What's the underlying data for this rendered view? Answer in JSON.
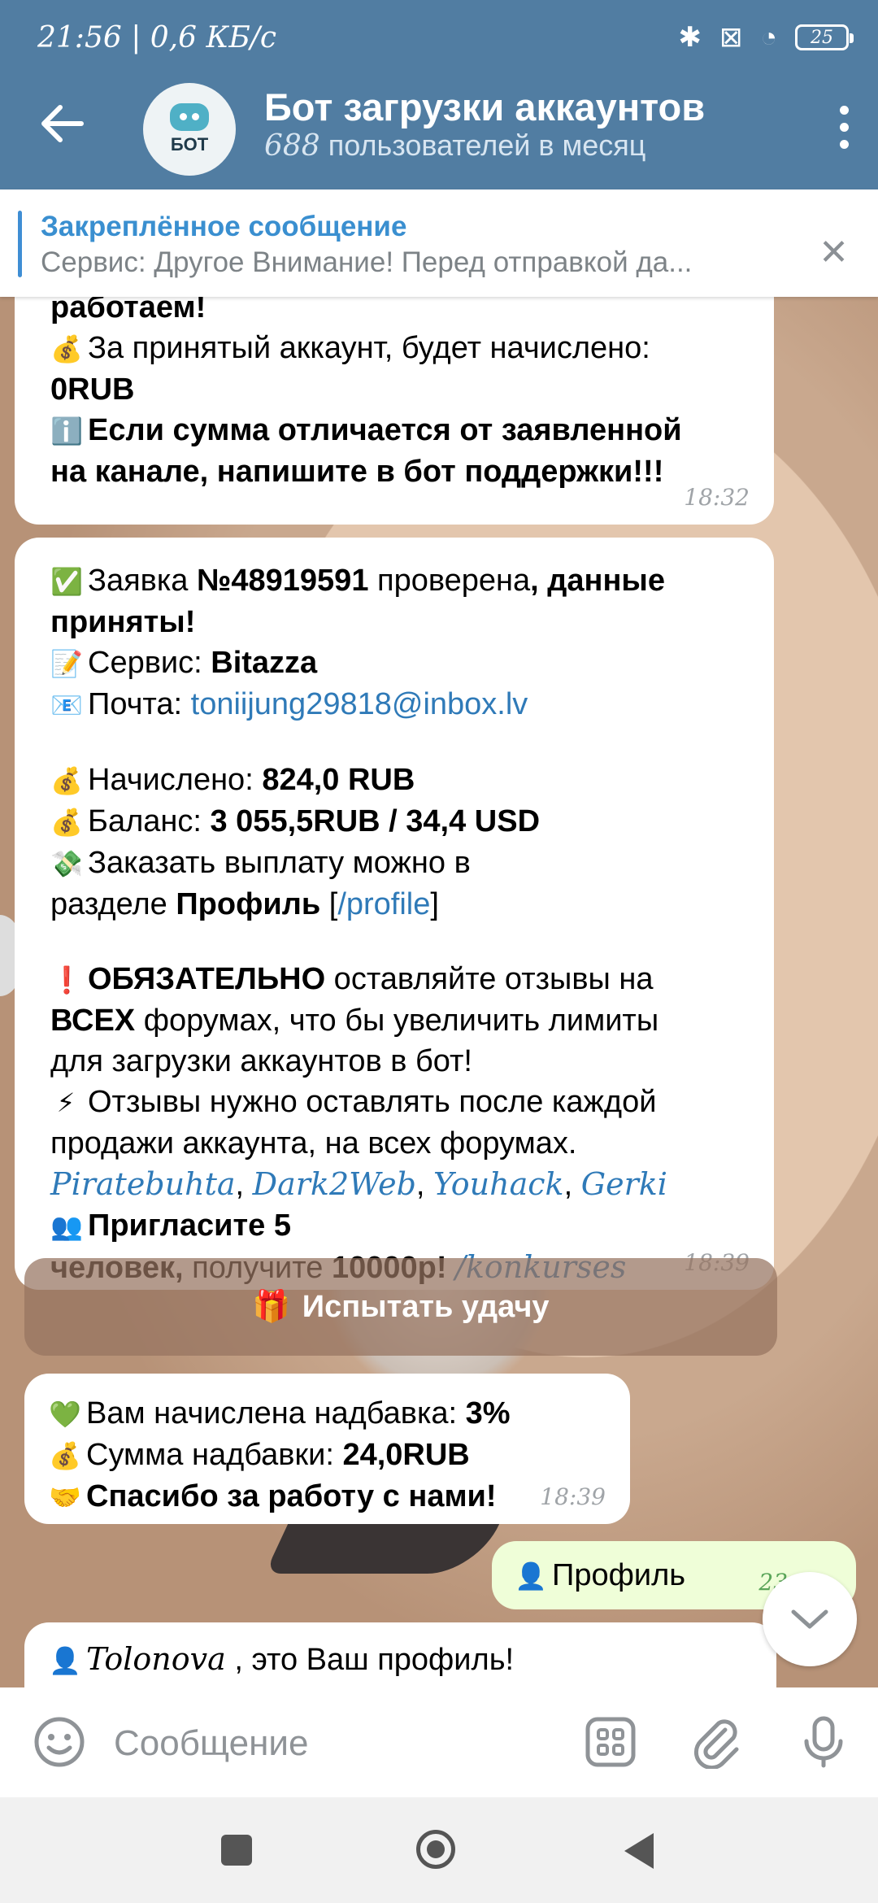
{
  "status_bar": {
    "time": "21:56",
    "speed": "0,6 КБ/с",
    "battery": "25"
  },
  "header": {
    "avatar_label": "БОТ",
    "title": "Бот загрузки аккаунтов",
    "subtitle_count": "688",
    "subtitle_text": "пользователей в месяц"
  },
  "pinned": {
    "title": "Закреплённое сообщение",
    "text": "Сервис: Другое  Внимание! Перед отправкой да..."
  },
  "messages": {
    "m1": {
      "partial_top": "работаем!",
      "line1": "За принятый аккаунт, будет начислено:",
      "line2": "0RUB",
      "line3": "Если сумма отличается от заявленной",
      "line4": "на канале,  напишите в бот поддержки!!!",
      "time": "18:32"
    },
    "m2": {
      "l1_a": "Заявка ",
      "l1_b": "№48919591",
      "l1_c": " проверена",
      "l1_d": ", данные",
      "l2": "приняты!",
      "service_label": "Сервис: ",
      "service_value": "Bitazza",
      "mail_label": "Почта: ",
      "mail_value": "toniijung29818@inbox.lv",
      "accrued_label": "Начислено: ",
      "accrued_value": "824,0 RUB",
      "balance_label": "Баланс: ",
      "balance_value": "3 055,5RUB  / 34,4 USD",
      "payout_1": "Заказать выплату можно в",
      "payout_2a": "разделе ",
      "payout_2b": "Профиль",
      "payout_2c": " [",
      "payout_2d": "/profile",
      "payout_2e": "]",
      "warn_a": "ОБЯЗАТЕЛЬНО",
      "warn_b": " оставляйте отзывы на",
      "warn2_a": "ВСЕХ",
      "warn2_b": " форумах, что бы увеличить лимиты",
      "warn3": "для загрузки аккаунтов в бот!",
      "reviews_1": "Отзывы нужно оставлять после каждой",
      "reviews_2": "продажи аккаунта, на всех форумах.",
      "forum1": "Piratebuhta",
      "forum2": "Dark2Web",
      "forum3": "Youhack",
      "forum4": "Gerki",
      "invite_1": "Пригласите 5",
      "invite_2a": "человек,",
      "invite_2b": " получите ",
      "invite_2c": "10000р!",
      "invite_link": "/konkurses",
      "time": "18:39"
    },
    "button": {
      "label": "Испытать удачу"
    },
    "m3": {
      "l1_a": "Вам начислена надбавка: ",
      "l1_b": "3%",
      "l2_a": "Сумма надбавки: ",
      "l2_b": "24,0RUB",
      "l3": "Спасибо за работу с нами!",
      "time": "18:39"
    },
    "m4": {
      "text": "Профиль",
      "time": "23:5..."
    },
    "m5": {
      "name": "Tolonova",
      "text": " , это Ваш профиль!"
    }
  },
  "input": {
    "placeholder": "Сообщение"
  },
  "colors": {
    "header_bg": "#517da2",
    "link": "#2f7ab8",
    "outgoing_bubble": "#effed8"
  }
}
